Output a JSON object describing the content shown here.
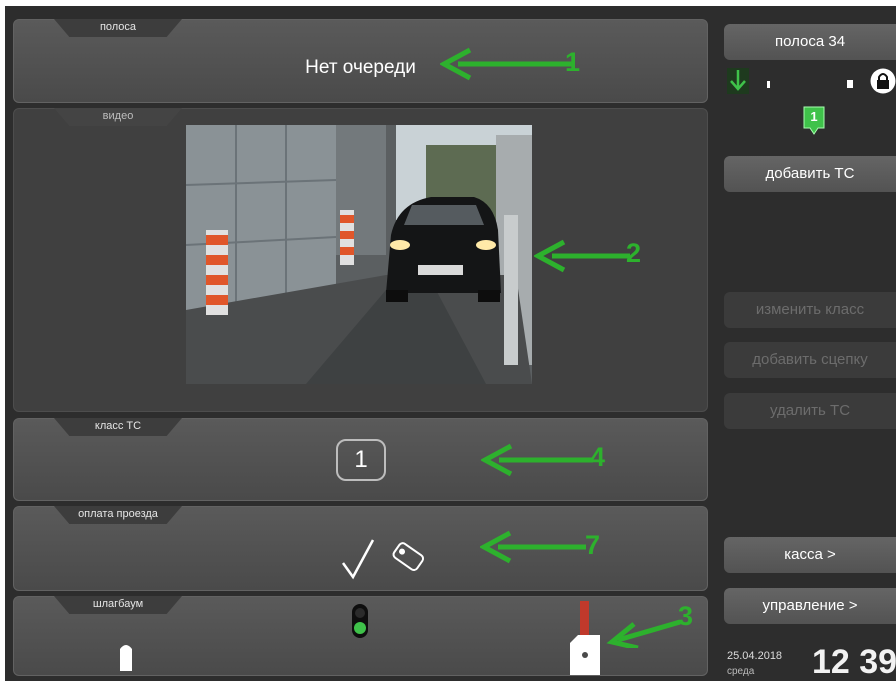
{
  "lane_panel": {
    "tab_label": "полоса",
    "queue_status": "Нет очереди"
  },
  "video_panel": {
    "tab_label": "видео"
  },
  "class_panel": {
    "tab_label": "класс ТС",
    "vehicle_class": "1"
  },
  "payment_panel": {
    "tab_label": "оплата проезда"
  },
  "barrier_panel": {
    "tab_label": "шлагбаум"
  },
  "annotations": {
    "n1": "1",
    "n2": "2",
    "n3": "3",
    "n4": "4",
    "n7": "7"
  },
  "sidebar": {
    "lane_button": "полоса 34",
    "queue_badge": "1",
    "add_vehicle": "добавить ТС",
    "change_class": "изменить класс",
    "add_trailer": "добавить сцепку",
    "delete_vehicle": "удалить ТС",
    "cashbox": "касса >",
    "management": "управление >"
  },
  "clock": {
    "date": "25.04.2018",
    "weekday": "среда",
    "time": "12 39"
  },
  "colors": {
    "annotation_green": "#2db12d",
    "signal_green": "#3fc24a",
    "barrier_red": "#c0392b"
  }
}
